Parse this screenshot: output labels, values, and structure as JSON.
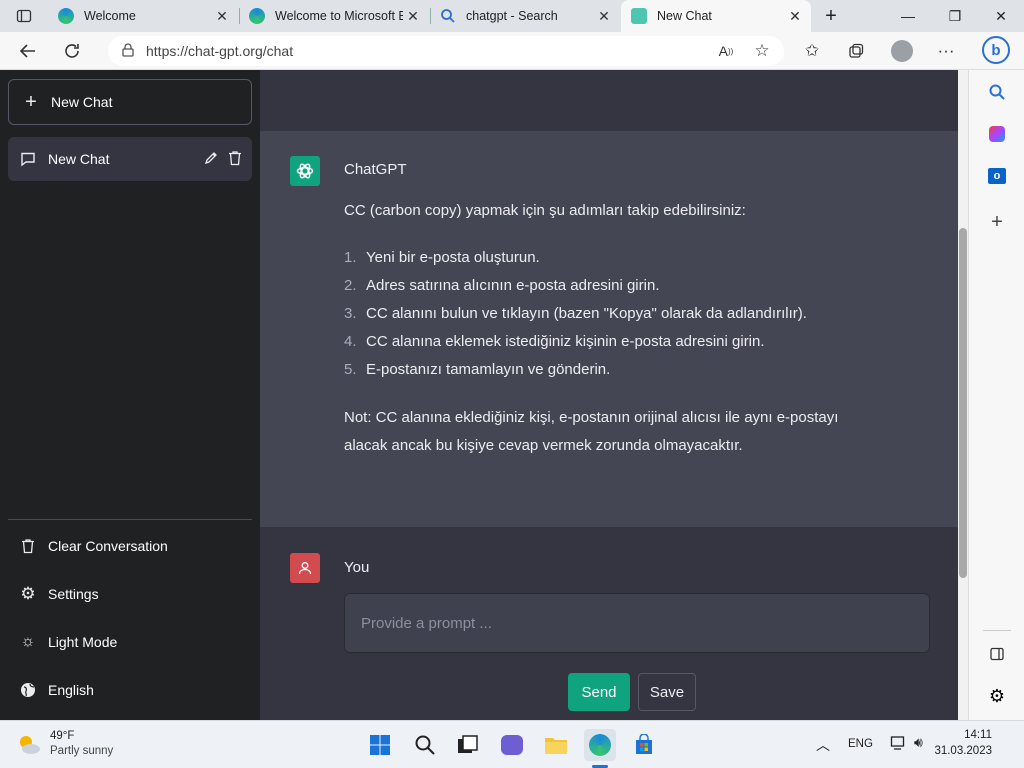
{
  "browser": {
    "tabs": [
      {
        "title": "Welcome",
        "active": false
      },
      {
        "title": "Welcome to Microsoft E",
        "active": false
      },
      {
        "title": "chatgpt - Search",
        "active": false
      },
      {
        "title": "New Chat",
        "active": true
      }
    ],
    "url": "https://chat-gpt.org/chat"
  },
  "sidebar": {
    "new_chat_label": "New Chat",
    "chats": [
      {
        "label": "New Chat"
      }
    ],
    "bottom": {
      "clear": "Clear Conversation",
      "settings": "Settings",
      "light_mode": "Light Mode",
      "language": "English"
    }
  },
  "conversation": {
    "assistant_name": "ChatGPT",
    "intro": "CC (carbon copy) yapmak için şu adımları takip edebilirsiniz:",
    "steps": [
      {
        "num": "1.",
        "text": "Yeni bir e-posta oluşturun."
      },
      {
        "num": "2.",
        "text": "Adres satırına alıcının e-posta adresini girin."
      },
      {
        "num": "3.",
        "text": "CC alanını bulun ve tıklayın (bazen \"Kopya\" olarak da adlandırılır)."
      },
      {
        "num": "4.",
        "text": "CC alanına eklemek istediğiniz kişinin e-posta adresini girin."
      },
      {
        "num": "5.",
        "text": "E-postanızı tamamlayın ve gönderin."
      }
    ],
    "note": "Not: CC alanına eklediğiniz kişi, e-postanın orijinal alıcısı ile aynı e-postayı alacak ancak bu kişiye cevap vermek zorunda olmayacaktır.",
    "user_name": "You"
  },
  "composer": {
    "placeholder": "Provide a prompt ...",
    "send_label": "Send",
    "save_label": "Save"
  },
  "taskbar": {
    "weather_temp": "49°F",
    "weather_desc": "Partly sunny",
    "language": "ENG",
    "time": "14:11",
    "date": "31.03.2023"
  },
  "colors": {
    "sidebar_bg": "#202123",
    "main_bg": "#343541",
    "assistant_bg": "#444654",
    "accent": "#10a37f",
    "user_avatar": "#d24b4e"
  }
}
